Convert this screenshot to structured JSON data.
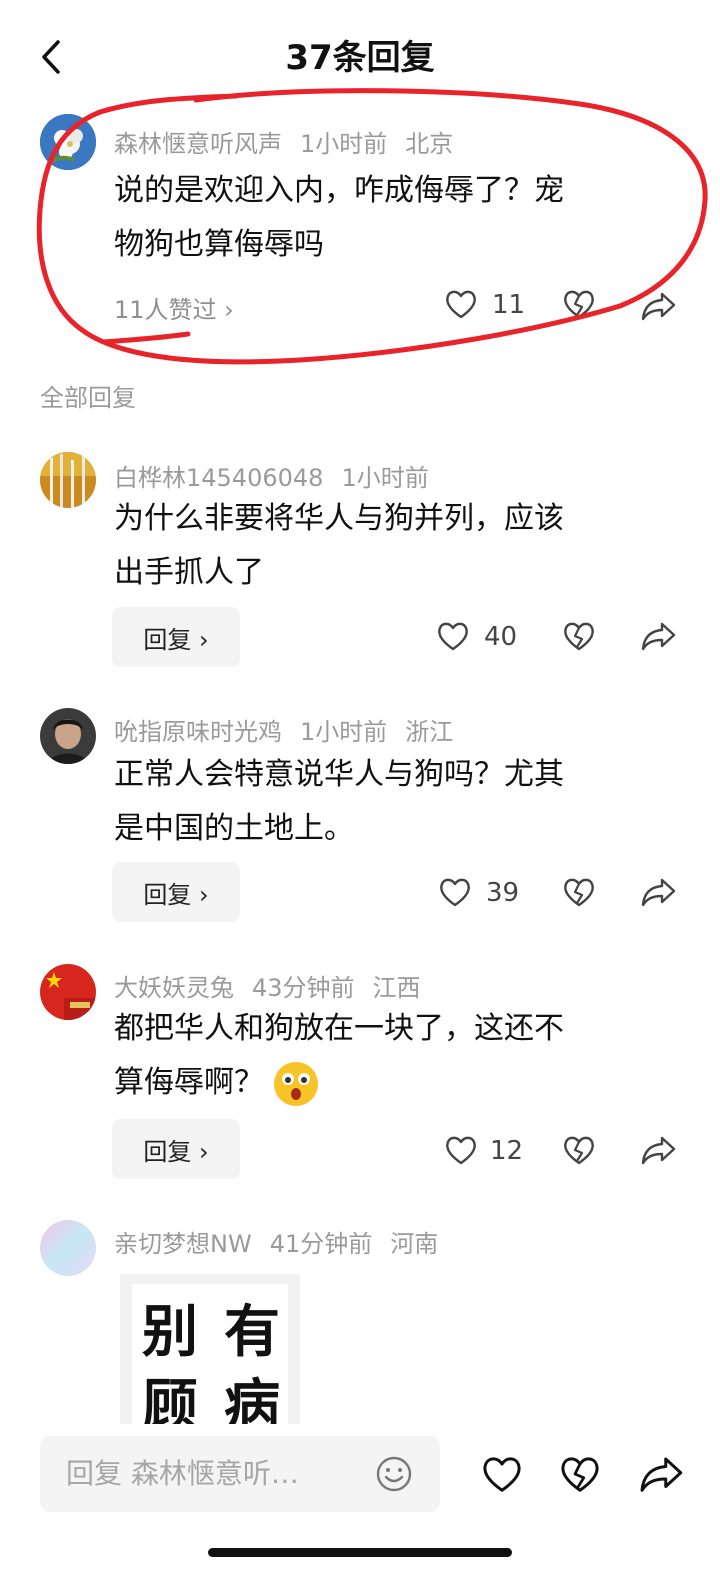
{
  "header": {
    "title": "37条回复"
  },
  "main_comment": {
    "user": "森林惬意听风声",
    "time": "1小时前",
    "location": "北京",
    "text_line1": "说的是欢迎入内，咋成侮辱了？宠",
    "text_line2": "物狗也算侮辱吗",
    "liked_by": "11人赞过 ›",
    "likes": "11"
  },
  "section_label": "全部回复",
  "replies": [
    {
      "user": "白桦林145406048",
      "time": "1小时前",
      "location": "",
      "text_line1": "为什么非要将华人与狗并列，应该",
      "text_line2": "出手抓人了",
      "reply_label": "回复 ›",
      "likes": "40"
    },
    {
      "user": "吮指原味时光鸡",
      "time": "1小时前",
      "location": "浙江",
      "text_line1": "正常人会特意说华人与狗吗？尤其",
      "text_line2": "是中国的土地上。",
      "reply_label": "回复 ›",
      "likes": "39"
    },
    {
      "user": "大妖妖灵兔",
      "time": "43分钟前",
      "location": "江西",
      "text_line1": "都把华人和狗放在一块了，这还不",
      "text_line2": "算侮辱啊？",
      "reply_label": "回复 ›",
      "likes": "12"
    },
    {
      "user": "亲切梦想NW",
      "time": "41分钟前",
      "location": "河南",
      "image_text": [
        "别",
        "有",
        "顾",
        "病"
      ]
    }
  ],
  "input": {
    "placeholder": "回复 森林惬意听…"
  },
  "colors": {
    "annotation_red": "#e8232a",
    "meta_gray": "#9a9a9a"
  }
}
